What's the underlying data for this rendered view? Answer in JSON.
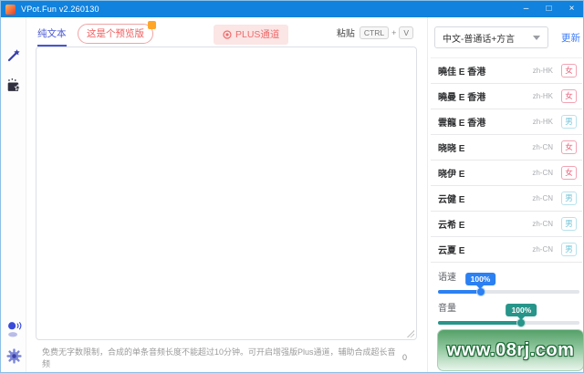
{
  "window": {
    "title": "VPot.Fun v2.260130",
    "minimize": "–",
    "maximize": "□",
    "close": "×"
  },
  "sidebar": {
    "icons": [
      "magic-wand-icon",
      "clapperboard-icon",
      "voice-speaker-icon",
      "settings-gear-icon"
    ]
  },
  "toolbar": {
    "tab_plain_text": "纯文本",
    "preview_button": "这是个预览版",
    "plus_channel": "PLUS通道",
    "paste_label": "粘贴",
    "key_ctrl": "CTRL",
    "key_plus": "+",
    "key_v": "V"
  },
  "editor": {
    "text_value": "",
    "footer_note": "免费无字数限制，合成的单条音频长度不能超过10分钟。可开启增强版Plus通道，辅助合成超长音频",
    "char_count": "0"
  },
  "voice_panel": {
    "language_select": "中文-普通话+方言",
    "update_label": "更新",
    "voices": [
      {
        "name": "曉佳 E 香港",
        "locale": "zh-HK",
        "gender": "女",
        "gender_type": "female"
      },
      {
        "name": "曉曼 E 香港",
        "locale": "zh-HK",
        "gender": "女",
        "gender_type": "female"
      },
      {
        "name": "雲龍 E 香港",
        "locale": "zh-HK",
        "gender": "男",
        "gender_type": "male"
      },
      {
        "name": "晓晓 E",
        "locale": "zh-CN",
        "gender": "女",
        "gender_type": "female"
      },
      {
        "name": "晓伊 E",
        "locale": "zh-CN",
        "gender": "女",
        "gender_type": "female"
      },
      {
        "name": "云健 E",
        "locale": "zh-CN",
        "gender": "男",
        "gender_type": "male"
      },
      {
        "name": "云希 E",
        "locale": "zh-CN",
        "gender": "男",
        "gender_type": "male"
      },
      {
        "name": "云夏 E",
        "locale": "zh-CN",
        "gender": "男",
        "gender_type": "male"
      }
    ],
    "sliders": [
      {
        "label": "语速",
        "value": "100%",
        "percent": 30,
        "color": "#2b80f2"
      },
      {
        "label": "音量",
        "value": "100%",
        "percent": 59,
        "color": "#27958a"
      }
    ]
  },
  "watermark": {
    "text": "www.08rj.com"
  },
  "colors": {
    "titlebar": "#1182dd",
    "active_tab": "#4656d2",
    "danger": "#f25c5c",
    "link": "#3e7bfa"
  }
}
